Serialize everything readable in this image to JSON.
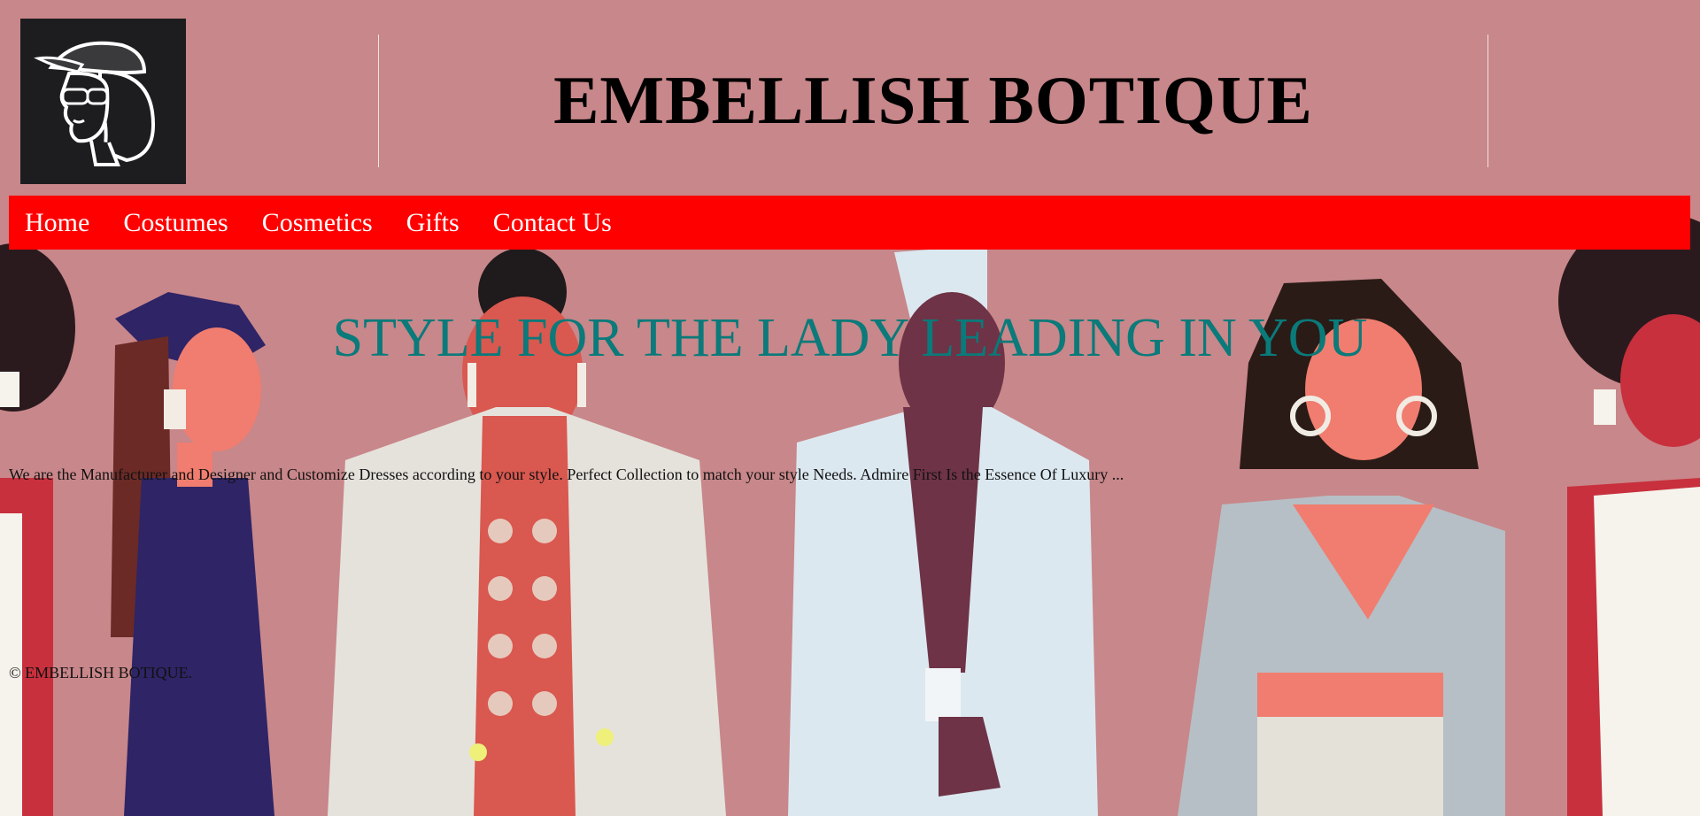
{
  "header": {
    "title": "EMBELLISH BOTIQUE",
    "logo_icon": "woman-with-cap-sunglasses-logo"
  },
  "nav": {
    "items": [
      {
        "label": "Home"
      },
      {
        "label": "Costumes"
      },
      {
        "label": "Cosmetics"
      },
      {
        "label": "Gifts"
      },
      {
        "label": "Contact Us"
      }
    ]
  },
  "hero": {
    "tagline": "STYLE FOR THE LADY LEADING IN YOU",
    "intro": "We are the Manufacturer and Designer and Customize Dresses according to your style. Perfect Collection to match your style Needs. Admire First Is the Essence Of Luxury ..."
  },
  "footer": {
    "copyright": "© EMBELLISH BOTIQUE."
  },
  "colors": {
    "background": "#c8878a",
    "nav_background": "#ff0000",
    "nav_text": "#ffffff",
    "tagline": "#0a7a7a",
    "title": "#000000"
  }
}
